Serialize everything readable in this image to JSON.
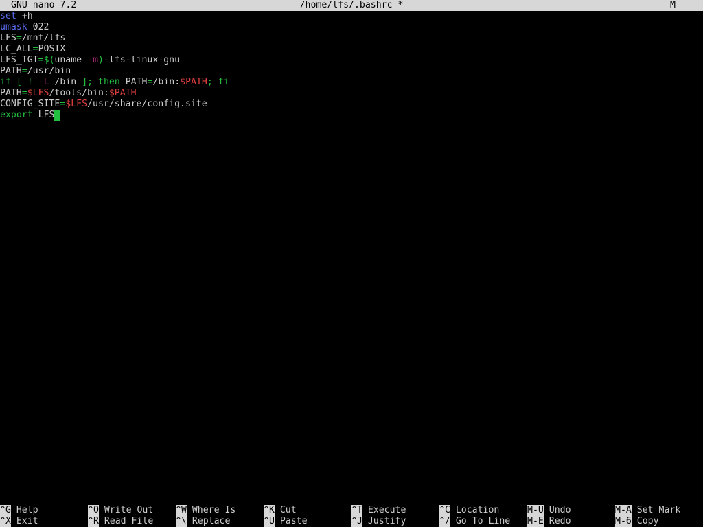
{
  "titlebar": {
    "app": "GNU nano 7.2",
    "file": "/home/lfs/.bashrc *",
    "modified": "M"
  },
  "editor": {
    "lines": [
      [
        {
          "t": "set",
          "c": "#5a6cf0"
        },
        {
          "t": " +h",
          "c": "#cccccc"
        }
      ],
      [
        {
          "t": "umask",
          "c": "#5a6cf0"
        },
        {
          "t": " 022",
          "c": "#cccccc"
        }
      ],
      [
        {
          "t": "LFS",
          "c": "#cccccc"
        },
        {
          "t": "=",
          "c": "#22c040"
        },
        {
          "t": "/mnt/lfs",
          "c": "#cccccc"
        }
      ],
      [
        {
          "t": "LC_ALL",
          "c": "#cccccc"
        },
        {
          "t": "=",
          "c": "#22c040"
        },
        {
          "t": "POSIX",
          "c": "#cccccc"
        }
      ],
      [
        {
          "t": "LFS_TGT",
          "c": "#cccccc"
        },
        {
          "t": "=",
          "c": "#22c040"
        },
        {
          "t": "$(",
          "c": "#22c040"
        },
        {
          "t": "uname ",
          "c": "#cccccc"
        },
        {
          "t": "-m",
          "c": "#d0308c"
        },
        {
          "t": ")",
          "c": "#22c040"
        },
        {
          "t": "-lfs-linux-gnu",
          "c": "#cccccc"
        }
      ],
      [
        {
          "t": "PATH",
          "c": "#cccccc"
        },
        {
          "t": "=",
          "c": "#22c040"
        },
        {
          "t": "/usr/bin",
          "c": "#cccccc"
        }
      ],
      [
        {
          "t": "if",
          "c": "#22c040"
        },
        {
          "t": " ",
          "c": "#cccccc"
        },
        {
          "t": "[",
          "c": "#22c040"
        },
        {
          "t": " ",
          "c": "#cccccc"
        },
        {
          "t": "!",
          "c": "#22c040"
        },
        {
          "t": " ",
          "c": "#cccccc"
        },
        {
          "t": "-L",
          "c": "#d0308c"
        },
        {
          "t": " /bin ",
          "c": "#cccccc"
        },
        {
          "t": "];",
          "c": "#22c040"
        },
        {
          "t": " ",
          "c": "#cccccc"
        },
        {
          "t": "then",
          "c": "#22c040"
        },
        {
          "t": " PATH",
          "c": "#cccccc"
        },
        {
          "t": "=",
          "c": "#22c040"
        },
        {
          "t": "/bin:",
          "c": "#cccccc"
        },
        {
          "t": "$PATH",
          "c": "#e04040"
        },
        {
          "t": ";",
          "c": "#22c040"
        },
        {
          "t": " ",
          "c": "#cccccc"
        },
        {
          "t": "fi",
          "c": "#22c040"
        }
      ],
      [
        {
          "t": "PATH",
          "c": "#cccccc"
        },
        {
          "t": "=",
          "c": "#22c040"
        },
        {
          "t": "$LFS",
          "c": "#e04040"
        },
        {
          "t": "/tools/bin:",
          "c": "#cccccc"
        },
        {
          "t": "$PATH",
          "c": "#e04040"
        }
      ],
      [
        {
          "t": "CONFIG_SITE",
          "c": "#cccccc"
        },
        {
          "t": "=",
          "c": "#22c040"
        },
        {
          "t": "$LFS",
          "c": "#e04040"
        },
        {
          "t": "/usr/share/config.site",
          "c": "#cccccc"
        }
      ],
      [
        {
          "t": "export",
          "c": "#22c040"
        },
        {
          "t": " LFS",
          "c": "#cccccc"
        }
      ]
    ],
    "cursor_line": 9
  },
  "shortcuts": {
    "row1": [
      {
        "key": "^G",
        "label": "Help"
      },
      {
        "key": "^O",
        "label": "Write Out"
      },
      {
        "key": "^W",
        "label": "Where Is"
      },
      {
        "key": "^K",
        "label": "Cut"
      },
      {
        "key": "^T",
        "label": "Execute"
      },
      {
        "key": "^C",
        "label": "Location"
      },
      {
        "key": "M-U",
        "label": "Undo"
      },
      {
        "key": "M-A",
        "label": "Set Mark"
      }
    ],
    "row2": [
      {
        "key": "^X",
        "label": "Exit"
      },
      {
        "key": "^R",
        "label": "Read File"
      },
      {
        "key": "^\\",
        "label": "Replace"
      },
      {
        "key": "^U",
        "label": "Paste"
      },
      {
        "key": "^J",
        "label": "Justify"
      },
      {
        "key": "^/",
        "label": "Go To Line"
      },
      {
        "key": "M-E",
        "label": "Redo"
      },
      {
        "key": "M-6",
        "label": "Copy"
      }
    ]
  },
  "colors": {
    "background": "#000000",
    "text": "#cccccc",
    "keyword": "#22c040",
    "builtin": "#5a6cf0",
    "variable": "#e04040",
    "option": "#d0308c",
    "bar": "#d7d7d7",
    "cursor": "#22c040"
  }
}
